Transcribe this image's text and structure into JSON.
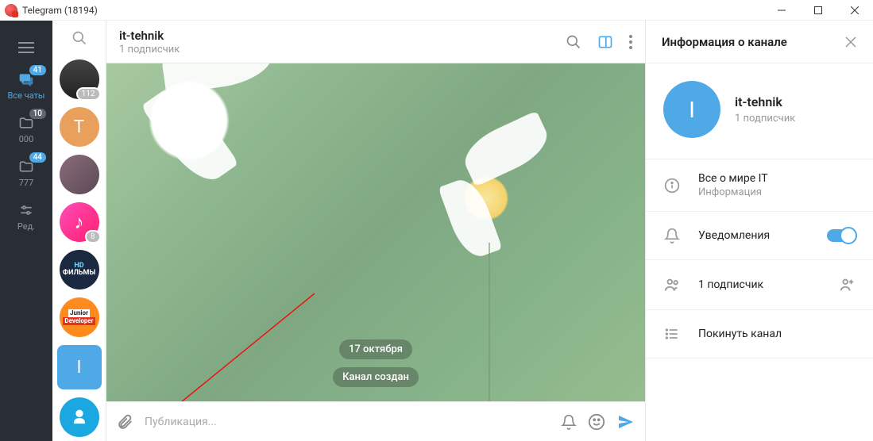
{
  "window": {
    "title": "Telegram (18194)"
  },
  "folders": {
    "allChats": {
      "label": "Все чаты",
      "badge": "41"
    },
    "f2": {
      "label": "000",
      "badge": "10"
    },
    "f3": {
      "label": "777",
      "badge": "44"
    },
    "edit": {
      "label": "Ред."
    }
  },
  "chats": {
    "c1": {
      "badge": "112"
    },
    "c2": {
      "letter": "T"
    },
    "c5": {
      "badge": "8"
    },
    "c8": {
      "letter": "I"
    }
  },
  "header": {
    "title": "it-tehnik",
    "subtitle": "1 подписчик"
  },
  "messages": {
    "date": "17 октября",
    "system": "Канал создан"
  },
  "input": {
    "placeholder": "Публикация..."
  },
  "info": {
    "panelTitle": "Информация о канале",
    "name": "it-tehnik",
    "initial": "I",
    "subscribers": "1 подписчик",
    "aboutLabel": "Все о мире IT",
    "aboutSub": "Информация",
    "notifications": "Уведомления",
    "members": "1 подписчик",
    "leave": "Покинуть канал"
  }
}
